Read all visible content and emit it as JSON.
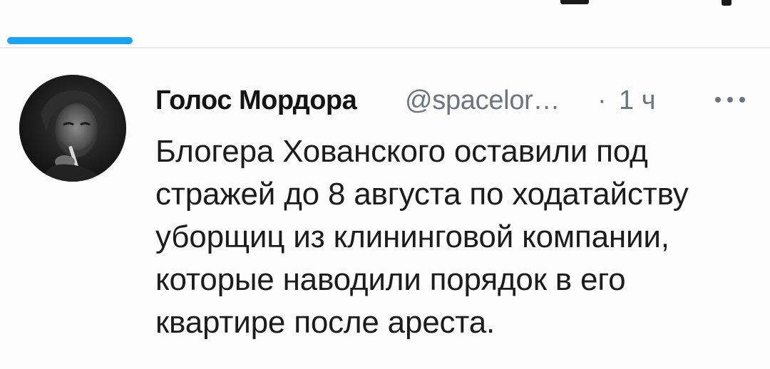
{
  "colors": {
    "accent": "#1da1f2",
    "text_primary": "#141414",
    "text_secondary": "#6b7680",
    "background": "#fdfdfd",
    "divider": "#e9ecef"
  },
  "tab_bar": {
    "active_indicator_color": "#1da1f2"
  },
  "tweet": {
    "author": {
      "name": "Голос Мордора",
      "handle": "@spacelor…",
      "avatar_icon": "user-avatar-photo"
    },
    "separator": "·",
    "timestamp": "1 ч",
    "more_icon": "more-horizontal-icon",
    "text_lines": [
      "Блогера Хованского оставили под",
      "стражей до 8 августа по ходатайству",
      "уборщиц из клининговой компании,",
      "которые наводили порядок в его",
      "квартире после ареста."
    ]
  }
}
